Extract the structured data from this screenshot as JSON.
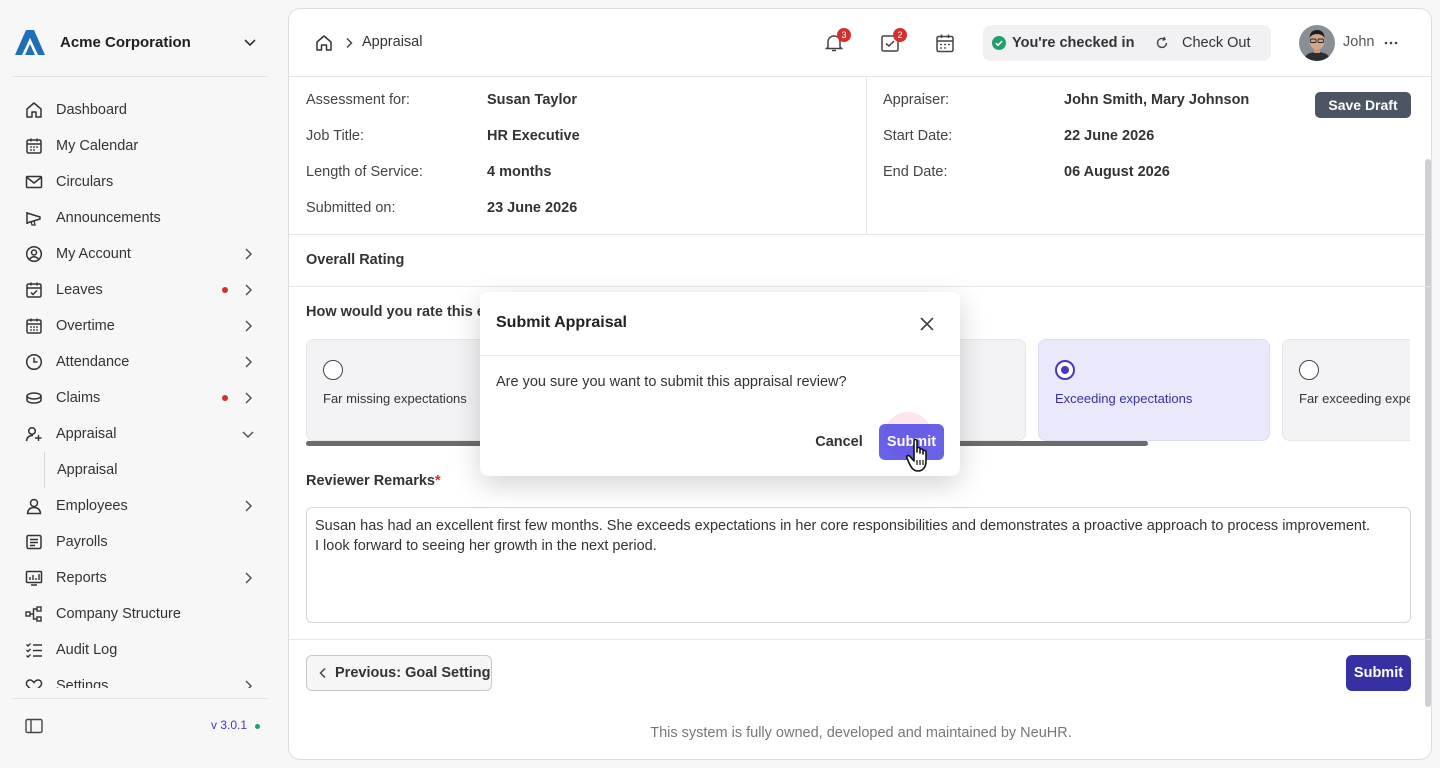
{
  "sidebar": {
    "company_name": "Acme Corporation",
    "items": [
      {
        "label": "Dashboard",
        "icon": "home-icon"
      },
      {
        "label": "My Calendar",
        "icon": "calendar-icon"
      },
      {
        "label": "Circulars",
        "icon": "mail-icon"
      },
      {
        "label": "Announcements",
        "icon": "megaphone-icon"
      },
      {
        "label": "My Account",
        "icon": "user-circle-icon"
      },
      {
        "label": "Leaves",
        "icon": "calendar-check-icon"
      },
      {
        "label": "Overtime",
        "icon": "calendar-grid-icon"
      },
      {
        "label": "Attendance",
        "icon": "clock-icon"
      },
      {
        "label": "Claims",
        "icon": "coins-icon"
      },
      {
        "label": "Appraisal",
        "icon": "user-star-icon"
      },
      {
        "label": "Appraisal",
        "icon": ""
      },
      {
        "label": "Employees",
        "icon": "user-icon"
      },
      {
        "label": "Payrolls",
        "icon": "receipt-icon"
      },
      {
        "label": "Reports",
        "icon": "chart-icon"
      },
      {
        "label": "Company Structure",
        "icon": "hierarchy-icon"
      },
      {
        "label": "Audit Log",
        "icon": "list-check-icon"
      },
      {
        "label": "Settings",
        "icon": "heart-icon"
      }
    ],
    "version": "v 3.0.1"
  },
  "header": {
    "breadcrumb": "Appraisal",
    "notifications_count": "3",
    "tasks_count": "2",
    "checkin_status": "You're checked in",
    "checkout_label": "Check Out",
    "user_name": "John"
  },
  "info": {
    "assessment_for_label": "Assessment for:",
    "assessment_for": "Susan Taylor",
    "job_title_label": "Job Title:",
    "job_title": "HR Executive",
    "service_label": "Length of Service:",
    "service": "4 months",
    "submitted_label": "Submitted on:",
    "submitted": "23 June 2026",
    "appraiser_label": "Appraiser:",
    "appraiser": "John Smith, Mary Johnson",
    "start_label": "Start Date:",
    "start": "22 June 2026",
    "end_label": "End Date:",
    "end": "06 August 2026",
    "save_draft": "Save Draft"
  },
  "rating": {
    "section_title": "Overall Rating",
    "question": "How would you rate this em",
    "options": [
      {
        "label": "Far missing expectations",
        "selected": false
      },
      {
        "label": "",
        "selected": false
      },
      {
        "label": "",
        "selected": false
      },
      {
        "label": "Exceeding expectations",
        "selected": true
      },
      {
        "label": "Far exceeding expectations",
        "selected": false
      }
    ],
    "selected_fraction_scrolled": 0.76
  },
  "remarks": {
    "label": "Reviewer Remarks",
    "required_mark": "*",
    "value": "Susan has had an excellent first few months. She exceeds expectations in her core responsibilities and demonstrates a proactive approach to process improvement.\nI look forward to seeing her growth in the next period."
  },
  "footer": {
    "prev_label": "Previous: Goal Setting",
    "submit_label": "Submit",
    "copyright": "This system is fully owned, developed and maintained by NeuHR."
  },
  "modal": {
    "title": "Submit Appraisal",
    "message": "Are you sure you want to submit this appraisal review?",
    "cancel_label": "Cancel",
    "submit_label": "Submit"
  },
  "colors": {
    "accent": "#3730a3",
    "alert": "#d32f2f",
    "success": "#22a06b"
  }
}
